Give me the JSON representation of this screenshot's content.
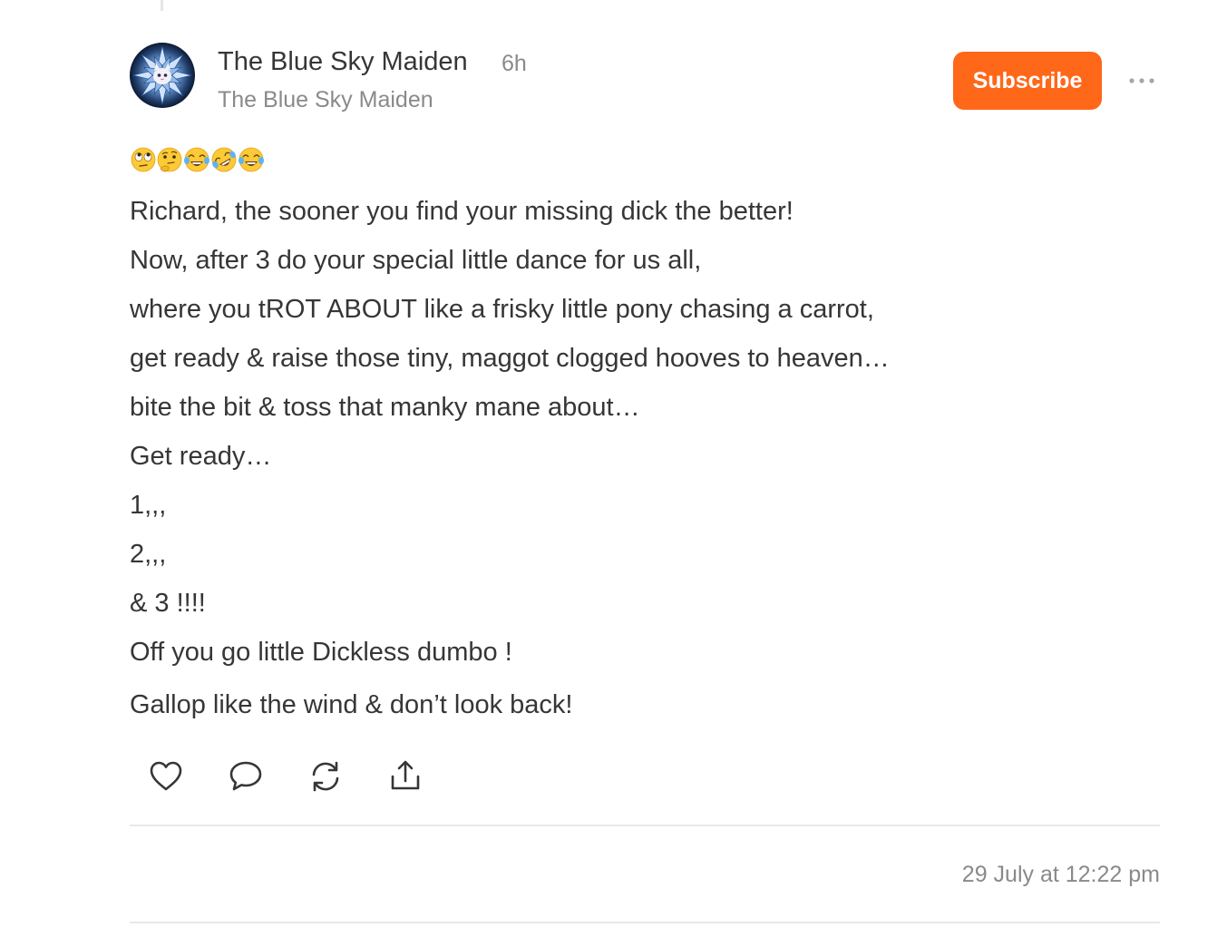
{
  "post": {
    "author": "The Blue Sky Maiden",
    "age": "6h",
    "publication": "The Blue Sky Maiden",
    "avatar_icon": "snowflake-avatar-icon",
    "subscribe_label": "Subscribe",
    "more_icon": "ellipsis-icon",
    "emojis": [
      "face-with-rolling-eyes",
      "thinking-face",
      "face-with-tears-of-joy",
      "rolling-on-the-floor-laughing",
      "face-with-tears-of-joy"
    ],
    "lines": [
      "Richard, the sooner you find your missing dick the better!",
      "Now, after 3 do your special little dance for us all,",
      "where you tROT ABOUT like a frisky little pony chasing a carrot,",
      "get ready & raise those tiny, maggot clogged hooves to heaven…",
      "bite the bit & toss that manky mane about…",
      "Get ready…",
      "1,,,",
      "2,,,",
      "& 3 !!!!",
      "Off you go little Dickless dumbo !",
      "Gallop like the wind & don’t look back!"
    ],
    "actions": {
      "like_icon": "heart-icon",
      "reply_icon": "comment-bubble-icon",
      "restack_icon": "restack-arrows-icon",
      "share_icon": "share-upload-icon"
    },
    "timestamp": "29 July at 12:22 pm"
  },
  "colors": {
    "accent": "#ff6719",
    "text": "#363636",
    "muted": "#8a8a8a",
    "divider": "#e8e8e8"
  }
}
